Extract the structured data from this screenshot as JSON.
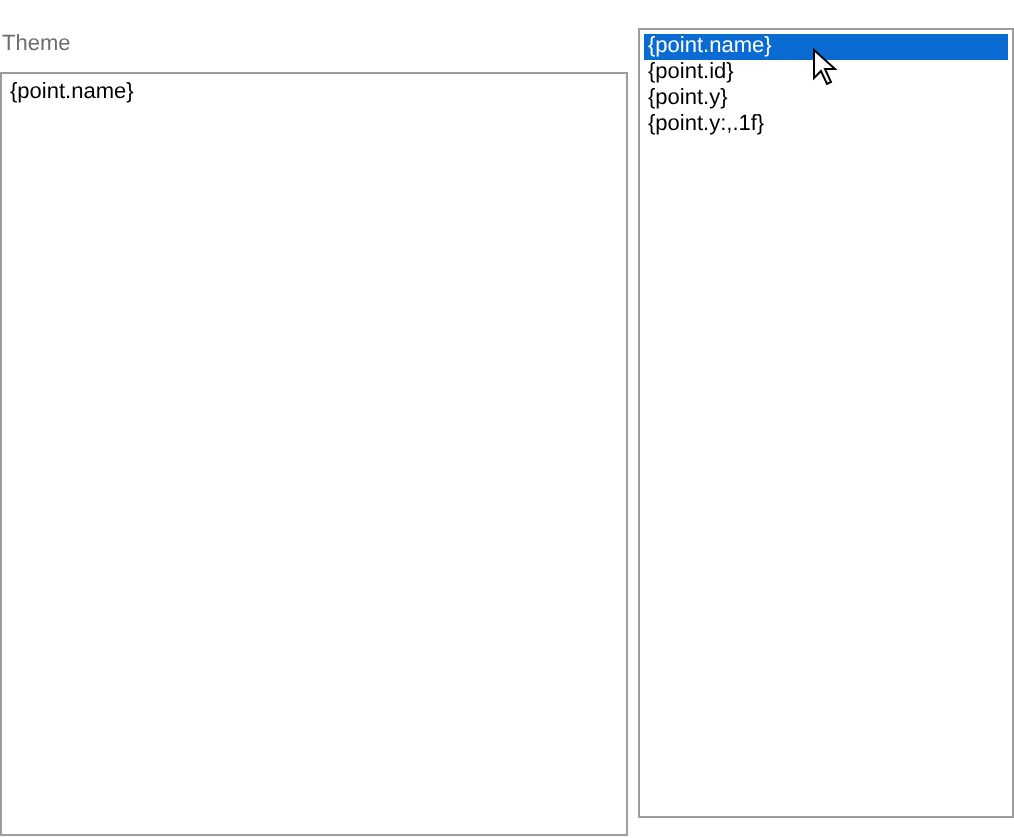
{
  "theme": {
    "label": "Theme",
    "value": "{point.name}"
  },
  "list": [
    {
      "label": "{point.name}",
      "selected": true
    },
    {
      "label": "{point.id}",
      "selected": false
    },
    {
      "label": "{point.y}",
      "selected": false
    },
    {
      "label": "{point.y:,.1f}",
      "selected": false
    }
  ]
}
